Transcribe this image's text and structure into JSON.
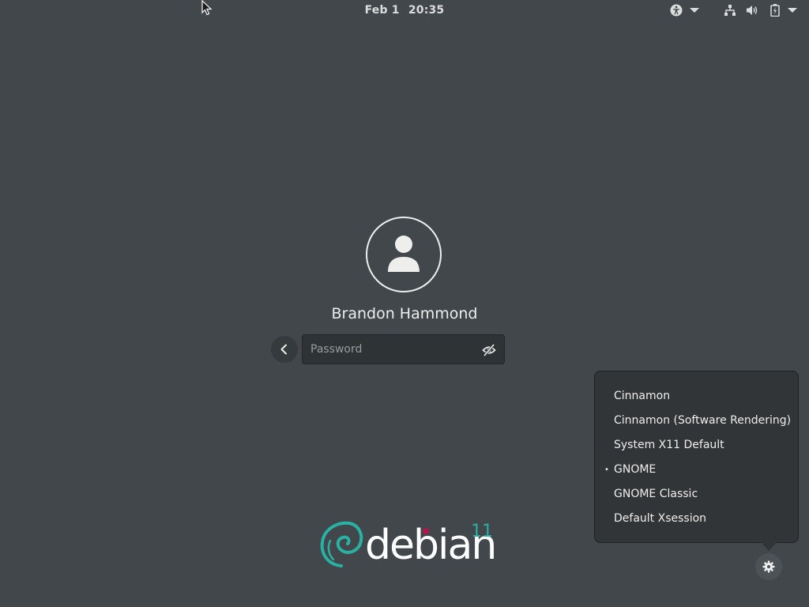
{
  "topbar": {
    "date": "Feb 1",
    "time": "20:35",
    "icons": [
      "accessibility-icon",
      "chevron-down-icon",
      "network-icon",
      "volume-icon",
      "battery-icon",
      "chevron-down-icon"
    ]
  },
  "login": {
    "username": "Brandon Hammond",
    "password_placeholder": "Password",
    "password_value": ""
  },
  "sessions": {
    "items": [
      {
        "label": "Cinnamon",
        "selected": false
      },
      {
        "label": "Cinnamon (Software Rendering)",
        "selected": false
      },
      {
        "label": "System X11 Default",
        "selected": false
      },
      {
        "label": "GNOME",
        "selected": true
      },
      {
        "label": "GNOME Classic",
        "selected": false
      },
      {
        "label": "Default Xsession",
        "selected": false
      }
    ],
    "bullet": "•"
  },
  "branding": {
    "wordmark": "debian",
    "version": "11"
  },
  "colors": {
    "background": "#41474b",
    "popover": "#323538",
    "debian_teal": "#29b2a4",
    "debian_red": "#b0174f"
  }
}
